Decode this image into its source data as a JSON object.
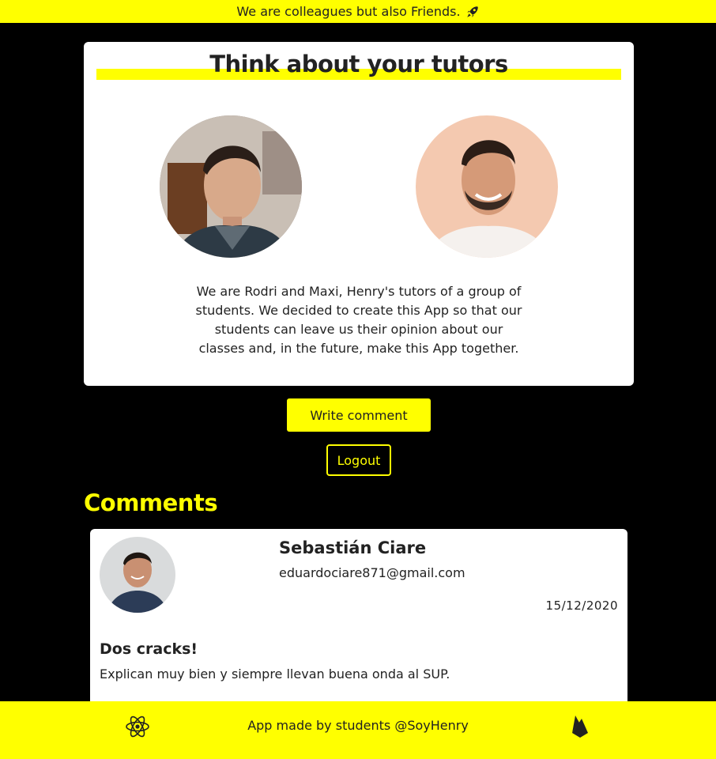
{
  "banner": {
    "text": "We are colleagues but also Friends.",
    "icon": "rocket-icon"
  },
  "tutors_card": {
    "title": "Think about your tutors",
    "tutors": [
      {
        "photo": "tutor-photo-rodri"
      },
      {
        "photo": "tutor-photo-maxi"
      }
    ],
    "intro": "We are Rodri and Maxi, Henry's tutors of a group of students. We decided to create this App so that our students can leave us their opinion about our classes and, in the future, make this App together."
  },
  "actions": {
    "write_comment_label": "Write comment",
    "logout_label": "Logout"
  },
  "comments": {
    "heading": "Comments",
    "items": [
      {
        "author": "Sebastián Ciare",
        "email": "eduardociare871@gmail.com",
        "date": "15/12/2020",
        "title": "Dos cracks!",
        "body": "Explican muy bien y siempre llevan buena onda al SUP."
      }
    ]
  },
  "footer": {
    "text": "App made by students @SoyHenry",
    "left_icon": "react-icon",
    "right_icon": "firebase-icon"
  },
  "colors": {
    "accent": "#ffff00",
    "background": "#000000",
    "card": "#ffffff",
    "text": "#222222"
  }
}
